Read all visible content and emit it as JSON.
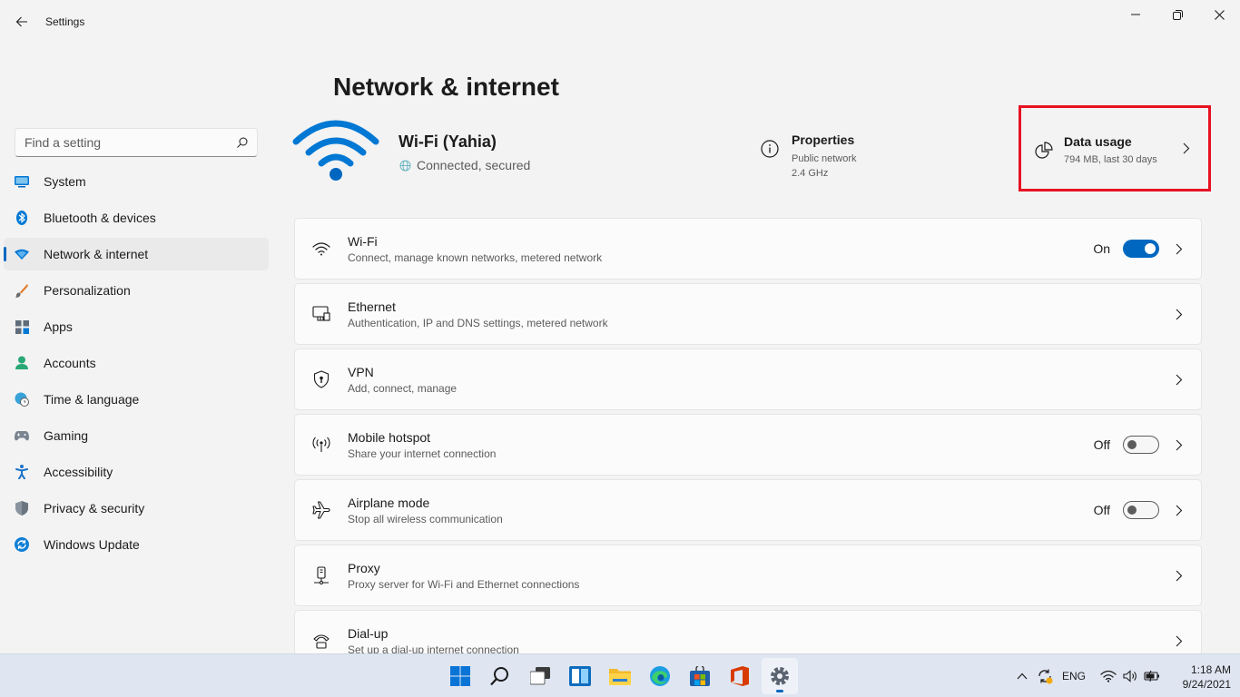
{
  "window": {
    "title": "Settings"
  },
  "search": {
    "placeholder": "Find a setting"
  },
  "nav": [
    {
      "label": "System",
      "icon": "monitor-icon"
    },
    {
      "label": "Bluetooth & devices",
      "icon": "bluetooth-icon"
    },
    {
      "label": "Network & internet",
      "icon": "wifi-diamond-icon",
      "active": true
    },
    {
      "label": "Personalization",
      "icon": "brush-icon"
    },
    {
      "label": "Apps",
      "icon": "apps-icon"
    },
    {
      "label": "Accounts",
      "icon": "person-icon"
    },
    {
      "label": "Time & language",
      "icon": "globe-clock-icon"
    },
    {
      "label": "Gaming",
      "icon": "gamepad-icon"
    },
    {
      "label": "Accessibility",
      "icon": "accessibility-icon"
    },
    {
      "label": "Privacy & security",
      "icon": "shield-icon"
    },
    {
      "label": "Windows Update",
      "icon": "update-icon"
    }
  ],
  "page": {
    "title": "Network & internet"
  },
  "hero": {
    "name": "Wi-Fi (Yahia)",
    "status": "Connected, secured",
    "properties": {
      "title": "Properties",
      "line1": "Public network",
      "line2": "2.4 GHz"
    },
    "data_usage": {
      "title": "Data usage",
      "sub": "794 MB, last 30 days"
    }
  },
  "cards": [
    {
      "title": "Wi-Fi",
      "sub": "Connect, manage known networks, metered network",
      "toggle": "On"
    },
    {
      "title": "Ethernet",
      "sub": "Authentication, IP and DNS settings, metered network"
    },
    {
      "title": "VPN",
      "sub": "Add, connect, manage"
    },
    {
      "title": "Mobile hotspot",
      "sub": "Share your internet connection",
      "toggle": "Off"
    },
    {
      "title": "Airplane mode",
      "sub": "Stop all wireless communication",
      "toggle": "Off"
    },
    {
      "title": "Proxy",
      "sub": "Proxy server for Wi-Fi and Ethernet connections"
    },
    {
      "title": "Dial-up",
      "sub": "Set up a dial-up internet connection"
    }
  ],
  "taskbar": {
    "language": "ENG",
    "time": "1:18 AM",
    "date": "9/24/2021"
  },
  "colors": {
    "accent": "#0067c0",
    "highlight_box": "#e81123"
  }
}
